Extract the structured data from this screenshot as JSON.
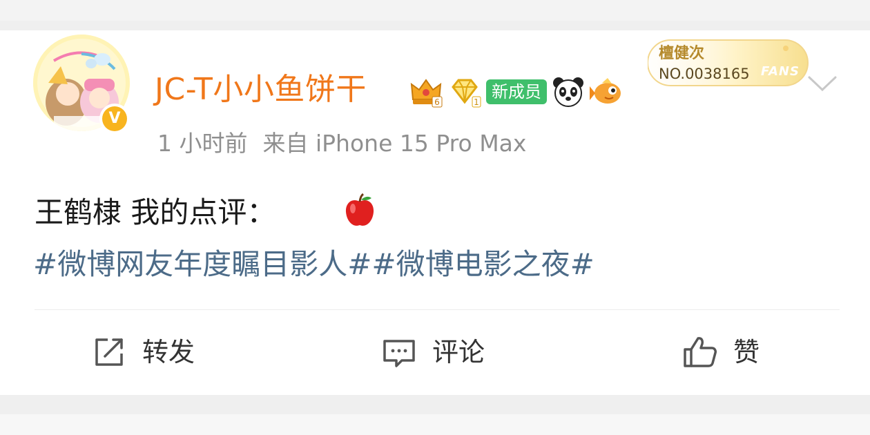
{
  "post": {
    "username": "JC-T小小鱼饼干",
    "new_member_badge": "新成员",
    "time": "1 小时前",
    "source": "来自 iPhone 15 Pro Max",
    "text": "王鹤棣 我的点评：",
    "hashtag_1": "#微博网友年度瞩目影人#",
    "hashtag_2": "#微博电影之夜#",
    "fan_card": {
      "name": "檀健次",
      "number": "NO.0038165",
      "label": "FANS"
    },
    "verified_badge": "V",
    "crown_level": "6",
    "diamond_level": "1"
  },
  "actions": {
    "repost": "转发",
    "comment": "评论",
    "like": "赞"
  },
  "colors": {
    "username": "#f0771a",
    "hashtag": "#4c6b88",
    "meta": "#8f8f8f",
    "new_badge": "#3fbf6b"
  },
  "icons": [
    "crown-icon",
    "diamond-icon",
    "panda-icon",
    "fish-icon",
    "apple-emoji-icon",
    "repost-icon",
    "comment-icon",
    "like-icon",
    "chevron-down-icon"
  ]
}
